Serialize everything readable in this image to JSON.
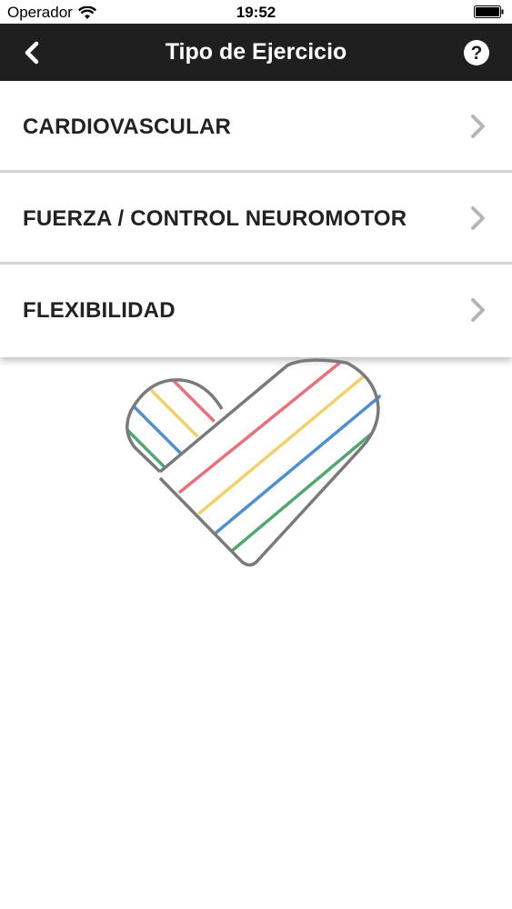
{
  "status_bar": {
    "carrier": "Operador",
    "time": "19:52"
  },
  "nav": {
    "title": "Tipo de Ejercicio",
    "back_icon": "chevron-left-icon",
    "help_icon": "question-circle-icon"
  },
  "menu": {
    "items": [
      {
        "label": "CARDIOVASCULAR"
      },
      {
        "label": "FUERZA / CONTROL NEUROMOTOR"
      },
      {
        "label": "FLEXIBILIDAD"
      }
    ]
  },
  "logo": {
    "icon": "striped-heart-logo",
    "colors": {
      "red": "#e8707a",
      "yellow": "#f2d16a",
      "blue": "#4f8fcf",
      "green": "#4fa86e",
      "outline": "#7a7a7a"
    }
  },
  "colors": {
    "nav_background": "#1f1f1f",
    "chevron": "#b5b5b5"
  }
}
